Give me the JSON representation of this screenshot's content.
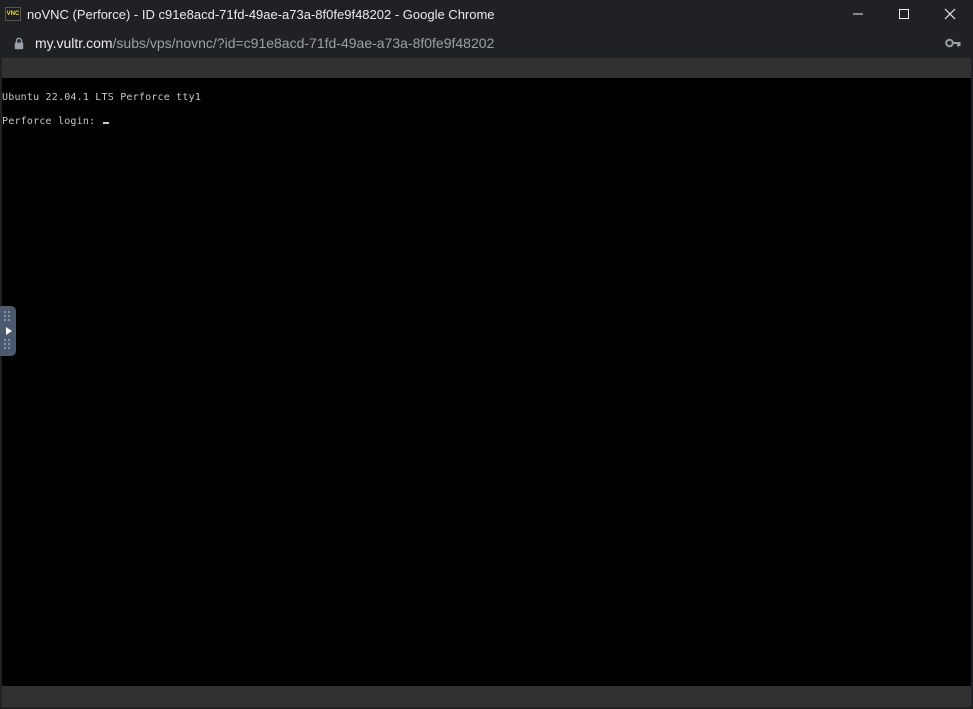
{
  "window": {
    "favicon_text": "VNC",
    "title": "noVNC (Perforce) - ID c91e8acd-71fd-49ae-a73a-8f0fe9f48202 - Google Chrome"
  },
  "address": {
    "host": "my.vultr.com",
    "path": "/subs/vps/novnc/?id=c91e8acd-71fd-49ae-a73a-8f0fe9f48202"
  },
  "terminal": {
    "banner": "Ubuntu 22.04.1 LTS Perforce tty1",
    "prompt": "Perforce login: "
  },
  "icons": {
    "lock": "lock-icon",
    "key": "key-icon",
    "minimize": "minimize-icon",
    "maximize": "maximize-icon",
    "close": "close-icon",
    "control_handle": "play-arrow-icon"
  },
  "colors": {
    "chrome_bg": "#202124",
    "terminal_bg": "#000000",
    "terminal_fg": "#c8c8c8",
    "novnc_strip": "#313131",
    "handle": "#4b5a6e"
  }
}
